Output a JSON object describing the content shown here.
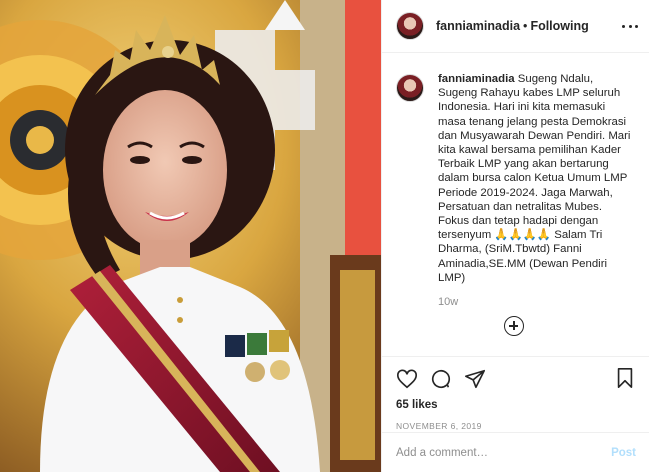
{
  "post": {
    "username": "fanniaminadia",
    "separator": "•",
    "follow_status": "Following",
    "photo_alt": "photo",
    "caption_username": "fanniaminadia",
    "caption_text": "Sugeng Ndalu, Sugeng Rahayu kabes LMP seluruh Indonesia. Hari ini kita memasuki masa tenang jelang pesta Demokrasi dan Musyawarah Dewan Pendiri. Mari kita kawal bersama pemilihan Kader Terbaik LMP yang akan bertarung dalam bursa calon Ketua Umum LMP Periode 2019-2024. Jaga Marwah, Persatuan dan netralitas Mubes. Fokus dan tetap hadapi dengan tersenyum 🙏🙏🙏🙏 Salam Tri Dharma, (SriM.Tbwtd) Fanni Aminadia,SE.MM (Dewan Pendiri LMP)",
    "time_ago": "10w",
    "likes": "65 likes",
    "date": "NOVEMBER 6, 2019"
  },
  "comment": {
    "placeholder": "Add a comment…",
    "post_label": "Post"
  },
  "icons": {
    "more": "more-options-icon",
    "like": "heart-icon",
    "comment": "comment-bubble-icon",
    "share": "paper-plane-icon",
    "save": "bookmark-icon",
    "load_more": "plus-circle-icon"
  },
  "colors": {
    "text": "#262626",
    "secondary": "#8e8e8e",
    "border": "#efefef",
    "post_disabled": "#b2dffc"
  }
}
